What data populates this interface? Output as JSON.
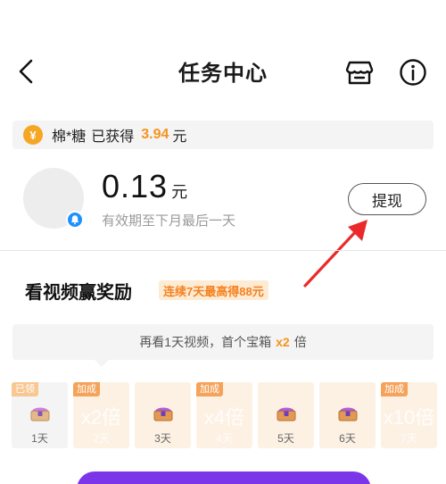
{
  "header": {
    "title": "任务中心"
  },
  "earnings": {
    "coin_symbol": "¥",
    "user": "棉*糖",
    "label": "已获得",
    "amount": "3.94",
    "unit": "元"
  },
  "balance": {
    "value": "0.13",
    "unit": "元",
    "expiry": "有效期至下月最后一天",
    "withdraw_label": "提现"
  },
  "section": {
    "title": "看视频赢奖励",
    "streak_badge": "连续7天最高得88元"
  },
  "tip": {
    "prefix": "再看1天视频，首个宝箱",
    "multiplier": "x2",
    "suffix": "倍"
  },
  "days": [
    {
      "tag": "已领",
      "label": "1天"
    },
    {
      "tag": "加成",
      "multiplier": "x2倍",
      "label": "2天"
    },
    {
      "label": "3天"
    },
    {
      "tag": "加成",
      "multiplier": "x4倍",
      "label": "4天"
    },
    {
      "label": "5天"
    },
    {
      "label": "6天"
    },
    {
      "tag": "加成",
      "multiplier": "x10倍",
      "label": "7天"
    }
  ],
  "colors": {
    "accent": "#f5941e",
    "primary": "#7b36ea",
    "badge_blue": "#1e90ff"
  }
}
